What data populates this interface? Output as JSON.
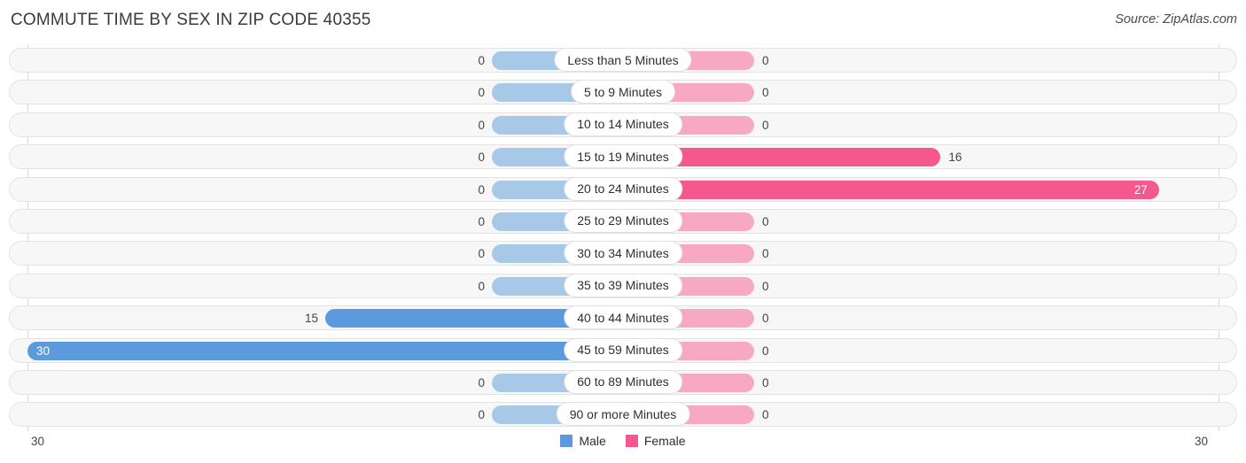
{
  "header": {
    "title": "COMMUTE TIME BY SEX IN ZIP CODE 40355",
    "source": "Source: ZipAtlas.com"
  },
  "legend": {
    "male_label": "Male",
    "female_label": "Female",
    "male_color": "#5b9bdd",
    "female_color": "#f4588c",
    "male_zero_color": "#a8c8e8",
    "female_zero_color": "#f7a9c4"
  },
  "axis": {
    "start_label": "30",
    "end_label": "30",
    "max": 30
  },
  "chart_data": {
    "type": "bar",
    "title": "COMMUTE TIME BY SEX IN ZIP CODE 40355",
    "subtitle": "Source: ZipAtlas.com",
    "orientation": "horizontal",
    "layout": "diverging-bidirectional",
    "xlabel": "",
    "ylabel": "",
    "xlim": [
      30,
      30
    ],
    "grid": true,
    "legend_position": "bottom-center",
    "categories": [
      "Less than 5 Minutes",
      "5 to 9 Minutes",
      "10 to 14 Minutes",
      "15 to 19 Minutes",
      "20 to 24 Minutes",
      "25 to 29 Minutes",
      "30 to 34 Minutes",
      "35 to 39 Minutes",
      "40 to 44 Minutes",
      "45 to 59 Minutes",
      "60 to 89 Minutes",
      "90 or more Minutes"
    ],
    "series": [
      {
        "name": "Male",
        "side": "left",
        "color": "#5b9bdd",
        "values": [
          0,
          0,
          0,
          0,
          0,
          0,
          0,
          0,
          15,
          30,
          0,
          0
        ]
      },
      {
        "name": "Female",
        "side": "right",
        "color": "#f4588c",
        "values": [
          0,
          0,
          0,
          16,
          27,
          0,
          0,
          0,
          0,
          0,
          0,
          0
        ]
      }
    ]
  }
}
